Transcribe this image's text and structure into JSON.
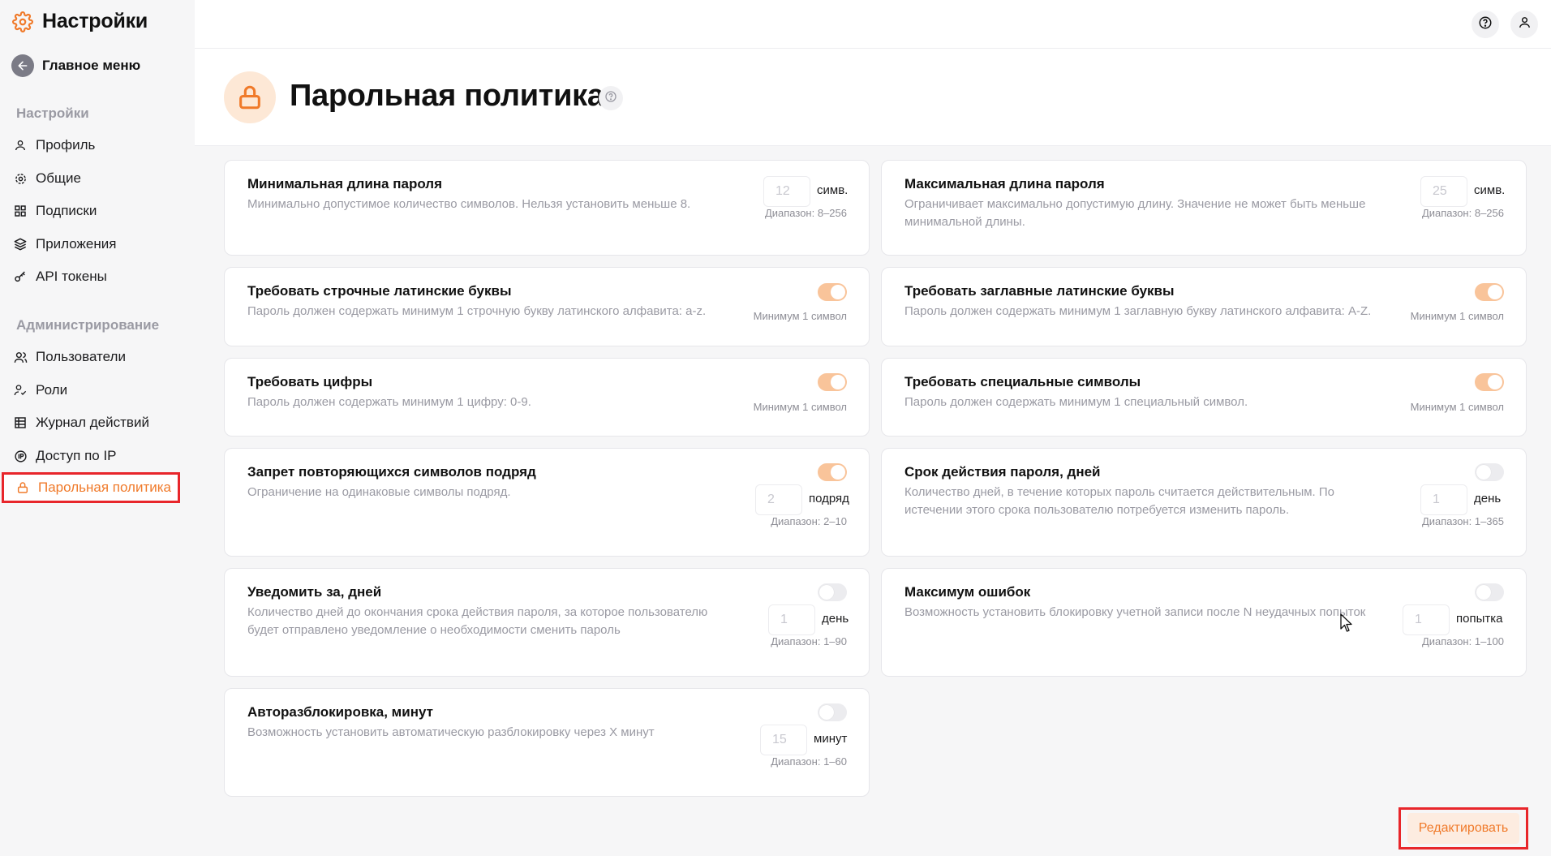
{
  "sidebar": {
    "app_title": "Настройки",
    "back_label": "Главное меню",
    "section_settings": "Настройки",
    "section_admin": "Администрирование",
    "items": [
      {
        "label": "Профиль",
        "icon": "user-icon"
      },
      {
        "label": "Общие",
        "icon": "gear-icon"
      },
      {
        "label": "Подписки",
        "icon": "grid-icon"
      },
      {
        "label": "Приложения",
        "icon": "layers-icon"
      },
      {
        "label": "API токены",
        "icon": "key-icon"
      },
      {
        "label": "Пользователи",
        "icon": "users-icon"
      },
      {
        "label": "Роли",
        "icon": "role-icon"
      },
      {
        "label": "Журнал действий",
        "icon": "table-icon"
      },
      {
        "label": "Доступ по IP",
        "icon": "ip-icon"
      },
      {
        "label": "Парольная политика",
        "icon": "lock-icon",
        "active": true
      }
    ]
  },
  "header": {
    "title": "Парольная политика"
  },
  "policies": [
    {
      "title": "Минимальная длина пароля",
      "desc": "Минимально допустимое количество символов. Нельзя установить меньше 8.",
      "value": "12",
      "unit": "симв.",
      "hint": "Диапазон: 8–256"
    },
    {
      "title": "Максимальная длина пароля",
      "desc": "Ограничивает максимально допустимую длину. Значение не может быть меньше минимальной длины.",
      "value": "25",
      "unit": "симв.",
      "hint": "Диапазон: 8–256"
    },
    {
      "title": "Требовать строчные латинские буквы",
      "desc": "Пароль должен содержать минимум 1 строчную букву латинского алфавита: a-z.",
      "toggle": "on",
      "hint": "Минимум 1 символ"
    },
    {
      "title": "Требовать заглавные латинские буквы",
      "desc": "Пароль должен содержать минимум 1 заглавную букву латинского алфавита: A-Z.",
      "toggle": "on",
      "hint": "Минимум 1 символ"
    },
    {
      "title": "Требовать цифры",
      "desc": "Пароль должен содержать минимум 1 цифру: 0-9.",
      "toggle": "on",
      "hint": "Минимум 1 символ"
    },
    {
      "title": "Требовать специальные символы",
      "desc": "Пароль должен содержать минимум 1 специальный символ.",
      "toggle": "on",
      "hint": "Минимум 1 символ"
    },
    {
      "title": "Запрет повторяющихся символов подряд",
      "desc": "Ограничение на одинаковые символы подряд.",
      "toggle": "on",
      "value": "2",
      "unit": "подряд",
      "hint": "Диапазон: 2–10"
    },
    {
      "title": "Срок действия пароля, дней",
      "desc": "Количество дней, в течение которых пароль считается действительным. По истечении этого срока пользователю потребуется изменить пароль.",
      "toggle": "off",
      "value": "1",
      "unit": "день",
      "hint": "Диапазон: 1–365"
    },
    {
      "title": "Уведомить за, дней",
      "desc": "Количество дней до окончания срока действия пароля, за которое пользователю будет отправлено уведомление о необходимости сменить пароль",
      "toggle": "off",
      "value": "1",
      "unit": "день",
      "hint": "Диапазон: 1–90"
    },
    {
      "title": "Максимум ошибок",
      "desc": "Возможность установить блокировку учетной записи после N неудачных попыток",
      "toggle": "off",
      "value": "1",
      "unit": "попытка",
      "hint": "Диапазон: 1–100"
    },
    {
      "title": "Авторазблокировка, минут",
      "desc": "Возможность установить автоматическую разблокировку через X минут",
      "toggle": "off",
      "value": "15",
      "unit": "минут",
      "hint": "Диапазон: 1–60"
    }
  ],
  "actions": {
    "edit_label": "Редактировать"
  },
  "colors": {
    "accent": "#f07a2a",
    "toggle_on": "#f9c49a",
    "highlight": "#e8262b"
  }
}
